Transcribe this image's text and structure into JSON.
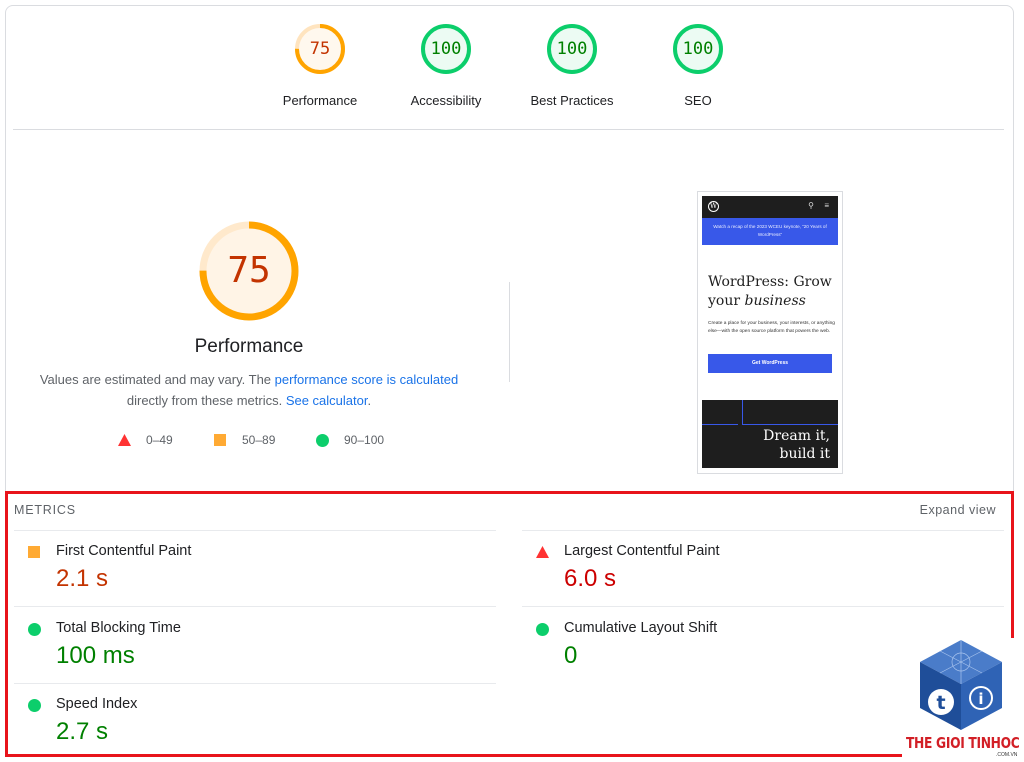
{
  "summary": [
    {
      "score": "75",
      "label": "Performance",
      "status": "average",
      "fraction": 0.75
    },
    {
      "score": "100",
      "label": "Accessibility",
      "status": "pass",
      "fraction": 1.0
    },
    {
      "score": "100",
      "label": "Best Practices",
      "status": "pass",
      "fraction": 1.0
    },
    {
      "score": "100",
      "label": "SEO",
      "status": "pass",
      "fraction": 1.0
    }
  ],
  "performance": {
    "score": "75",
    "fraction": 0.75,
    "title": "Performance",
    "desc_pre": "Values are estimated and may vary. The ",
    "desc_link1": "performance score is calculated",
    "desc_mid": " directly from these metrics. ",
    "desc_link2": "See calculator",
    "desc_post": "."
  },
  "legend": [
    {
      "range": "0–49",
      "shape": "triangle-icon",
      "color": "#ff3333"
    },
    {
      "range": "50–89",
      "shape": "square-icon",
      "color": "#ffaa33"
    },
    {
      "range": "90–100",
      "shape": "circle-icon",
      "color": "#0cce6b"
    }
  ],
  "screenshot": {
    "banner": "Watch a recap of the 2023 WCEU keynote, “20 Years of WordPress”",
    "hero_line1": "WordPress: Grow",
    "hero_line2_plain": "your ",
    "hero_line2_italic": "business",
    "sub": "Create a place for your business, your interests, or anything else—with the open source platform that powers the web.",
    "button": "Get WordPress",
    "dark_line1": "Dream it,",
    "dark_line2": "build it"
  },
  "metrics": {
    "heading": "METRICS",
    "expand": "Expand view",
    "items": [
      {
        "name": "First Contentful Paint",
        "value": "2.1 s",
        "status": "average"
      },
      {
        "name": "Largest Contentful Paint",
        "value": "6.0 s",
        "status": "fail"
      },
      {
        "name": "Total Blocking Time",
        "value": "100 ms",
        "status": "pass"
      },
      {
        "name": "Cumulative Layout Shift",
        "value": "0",
        "status": "pass"
      },
      {
        "name": "Speed Index",
        "value": "2.7 s",
        "status": "pass"
      }
    ]
  },
  "watermark": {
    "text": "THE GIOI TINHOC",
    "sub": ".COM.VN"
  },
  "colors": {
    "pass": "#0cce6b",
    "pass_text": "#008000",
    "average": "#ffa400",
    "average_text": "#c33300",
    "fail": "#ff3333",
    "fail_text": "#cc0000",
    "link": "#1a73e8",
    "highlight_border": "#e8141b"
  }
}
